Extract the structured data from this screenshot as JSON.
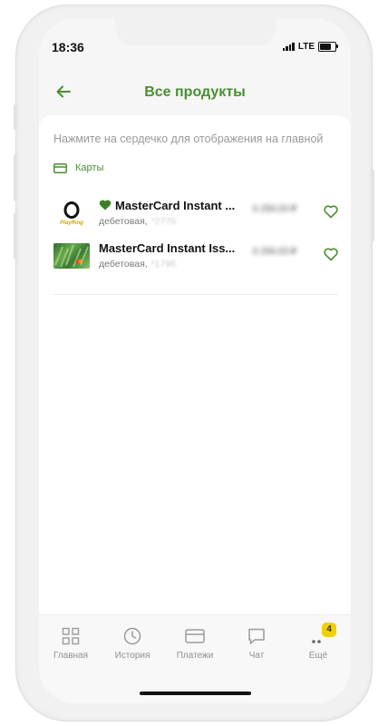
{
  "status_bar": {
    "time": "18:36",
    "network": "LTE"
  },
  "header": {
    "title": "Все продукты"
  },
  "hint": "Нажмите на сердечко для отображения на главной",
  "section": {
    "label": "Карты"
  },
  "products": [
    {
      "title": "MasterCard Instant ...",
      "subtitle": "дебетовая, ",
      "masked_number": "*2775",
      "amount": "6 256.03 ₽",
      "logo_text": "PlayRing",
      "pinned": true
    },
    {
      "title": "MasterCard Instant Iss...",
      "subtitle": "дебетовая, ",
      "masked_number": "*1796",
      "amount": "6 256.03 ₽",
      "pinned": false
    }
  ],
  "tabbar": [
    {
      "label": "Главная"
    },
    {
      "label": "История"
    },
    {
      "label": "Платежи"
    },
    {
      "label": "Чат"
    },
    {
      "label": "Ещё",
      "badge": "4"
    }
  ],
  "colors": {
    "accent": "#4a8f31",
    "badge": "#f0d000"
  }
}
